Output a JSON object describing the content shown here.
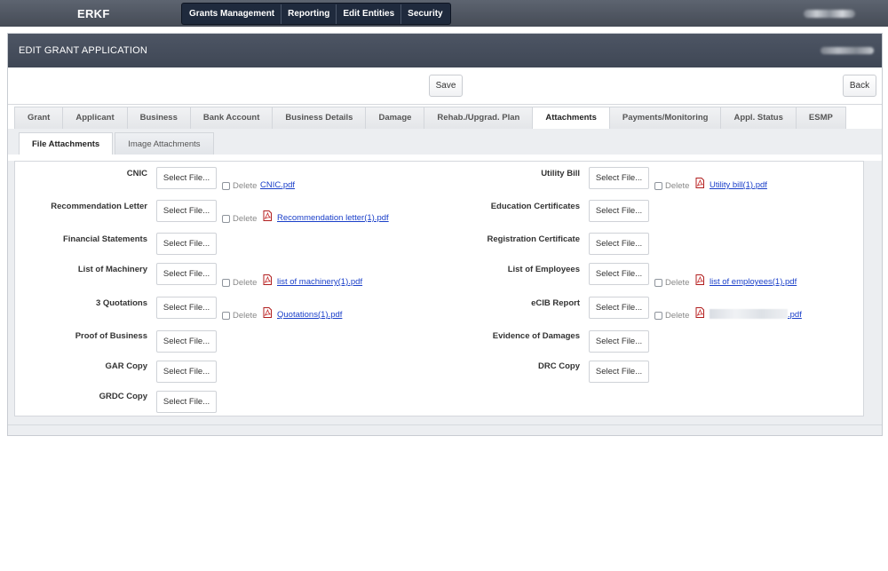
{
  "app": {
    "brand": "ERKF"
  },
  "nav": {
    "items": [
      "Grants Management",
      "Reporting",
      "Edit Entities",
      "Security"
    ]
  },
  "panel": {
    "title": "EDIT GRANT APPLICATION"
  },
  "toolbar": {
    "save_label": "Save",
    "back_label": "Back"
  },
  "tabs": {
    "items": [
      "Grant",
      "Applicant",
      "Business",
      "Bank Account",
      "Business Details",
      "Damage",
      "Rehab./Upgrad. Plan",
      "Attachments",
      "Payments/Monitoring",
      "Appl. Status",
      "ESMP"
    ],
    "active": "Attachments"
  },
  "subtabs": {
    "items": [
      "File Attachments",
      "Image Attachments"
    ],
    "active": "File Attachments"
  },
  "form": {
    "select_label": "Select File...",
    "delete_label": "Delete",
    "left": [
      {
        "label": "CNIC",
        "file": "CNIC.pdf",
        "pdf_icon": false
      },
      {
        "label": "Recommendation Letter",
        "file": "Recommendation letter(1).pdf",
        "pdf_icon": true
      },
      {
        "label": "Financial Statements"
      },
      {
        "label": "List of Machinery",
        "file": "list of machinery(1).pdf",
        "pdf_icon": true
      },
      {
        "label": "3 Quotations",
        "file": "Quotations(1).pdf",
        "pdf_icon": true
      },
      {
        "label": "Proof of Business"
      },
      {
        "label": "GAR Copy"
      },
      {
        "label": "GRDC Copy"
      }
    ],
    "right": [
      {
        "label": "Utility Bill",
        "file": "Utility bill(1).pdf",
        "pdf_icon": true
      },
      {
        "label": "Education Certificates"
      },
      {
        "label": "Registration Certificate"
      },
      {
        "label": "List of Employees",
        "file": "list of employees(1).pdf",
        "pdf_icon": true
      },
      {
        "label": "eCIB Report",
        "file": ".pdf",
        "pdf_icon": true,
        "redacted": true
      },
      {
        "label": "Evidence of Damages"
      },
      {
        "label": "DRC Copy"
      }
    ]
  },
  "icons": {
    "pdf": "pdf-file-icon"
  },
  "colors": {
    "link": "#1a3fc9",
    "header": "#454b56",
    "nav": "#1f2a3d"
  }
}
